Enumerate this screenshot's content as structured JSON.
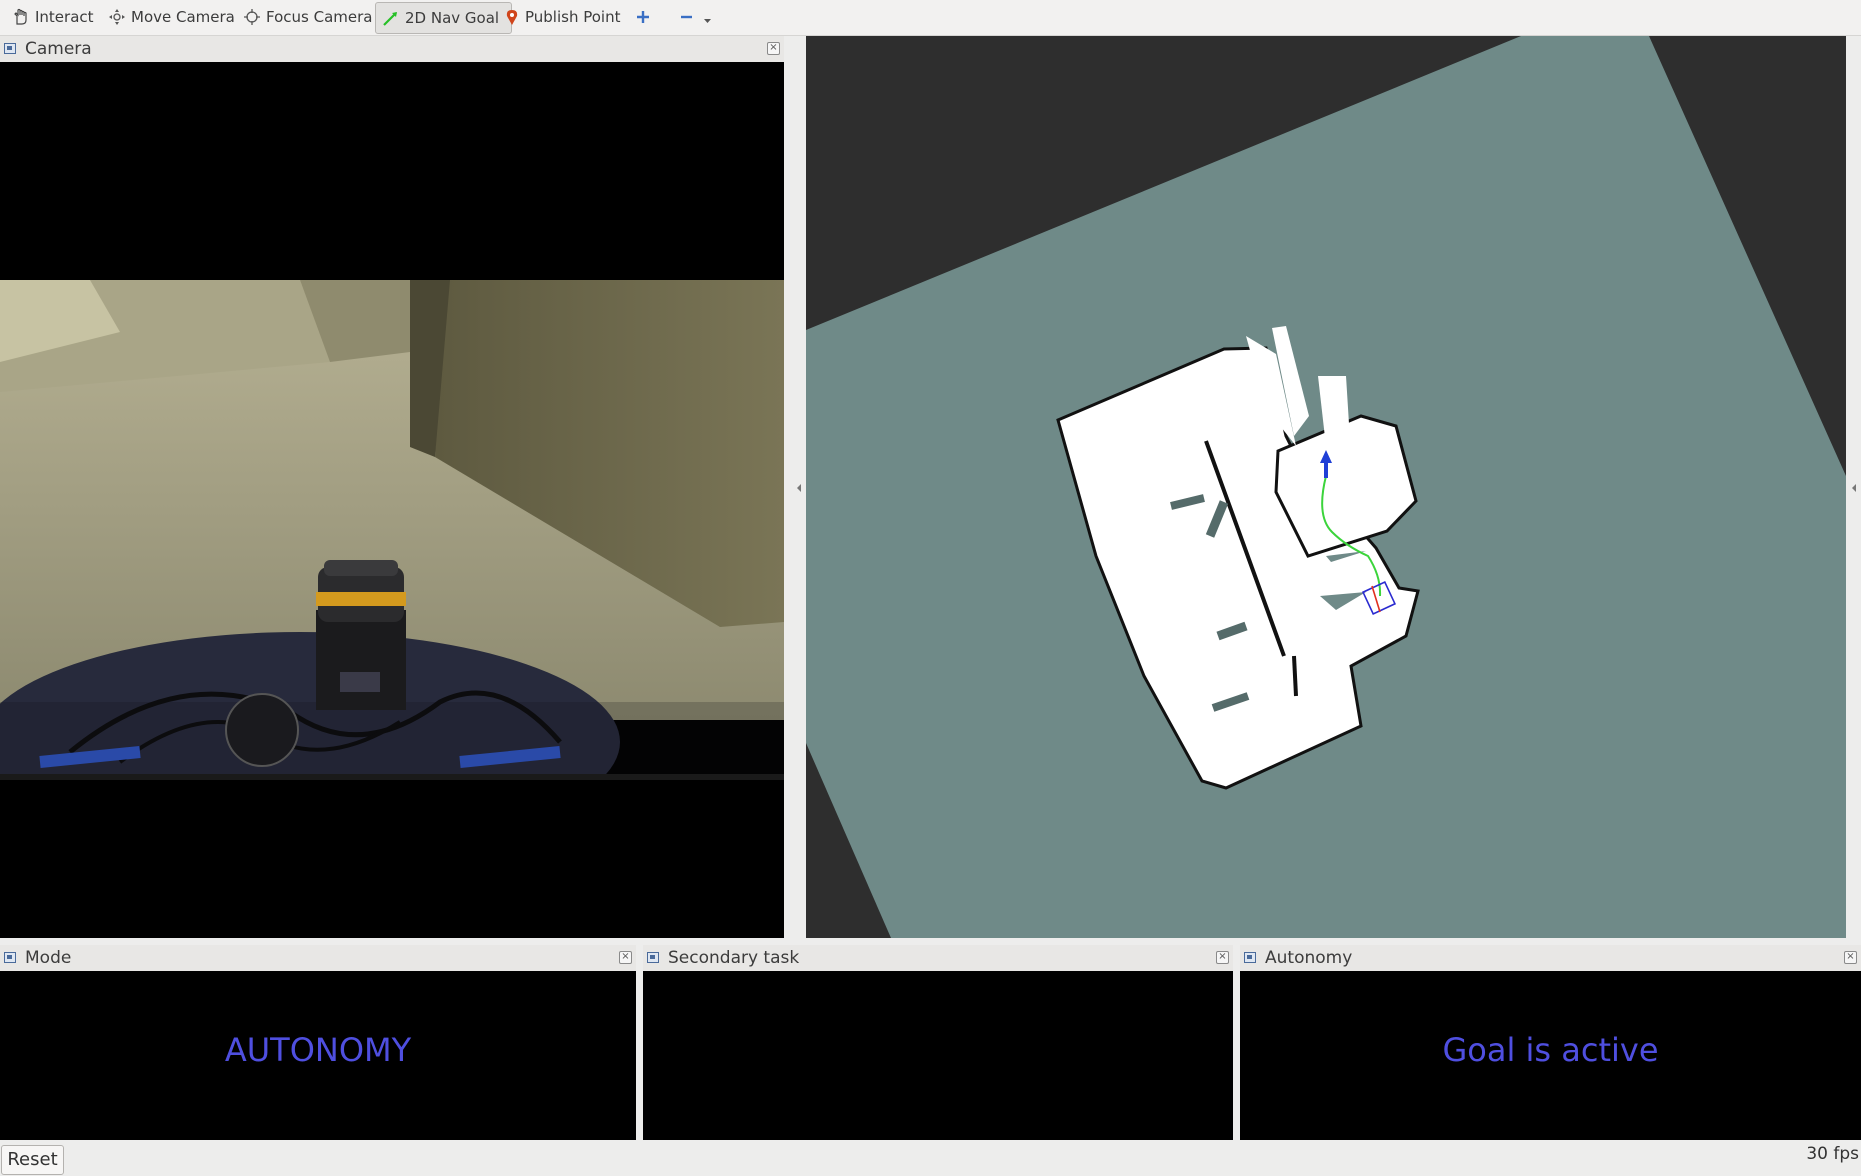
{
  "toolbar": {
    "tools": [
      {
        "label": "Interact",
        "icon": "hand-icon"
      },
      {
        "label": "Move Camera",
        "icon": "move-camera-icon"
      },
      {
        "label": "Focus Camera",
        "icon": "focus-camera-icon"
      },
      {
        "label": "2D Nav Goal",
        "icon": "nav-goal-arrow-icon",
        "active": true
      },
      {
        "label": "Publish Point",
        "icon": "map-pin-icon"
      }
    ],
    "add_icon": "plus-icon",
    "remove_icon": "minus-icon"
  },
  "panels": {
    "camera": {
      "title": "Camera"
    },
    "mode": {
      "title": "Mode",
      "text": "AUTONOMY"
    },
    "secondary": {
      "title": "Secondary task",
      "text": ""
    },
    "autonomy": {
      "title": "Autonomy",
      "text": "Goal is active"
    }
  },
  "status": {
    "reset_label": "Reset",
    "fps": "30 fps"
  },
  "colors": {
    "status_text": "#4f4fe0",
    "map_unknown": "#6f8a88",
    "map_free": "#ffffff",
    "map_background": "#2e2e2e",
    "path": "#3bd43b",
    "goal_arrow": "#1f3fd6"
  }
}
